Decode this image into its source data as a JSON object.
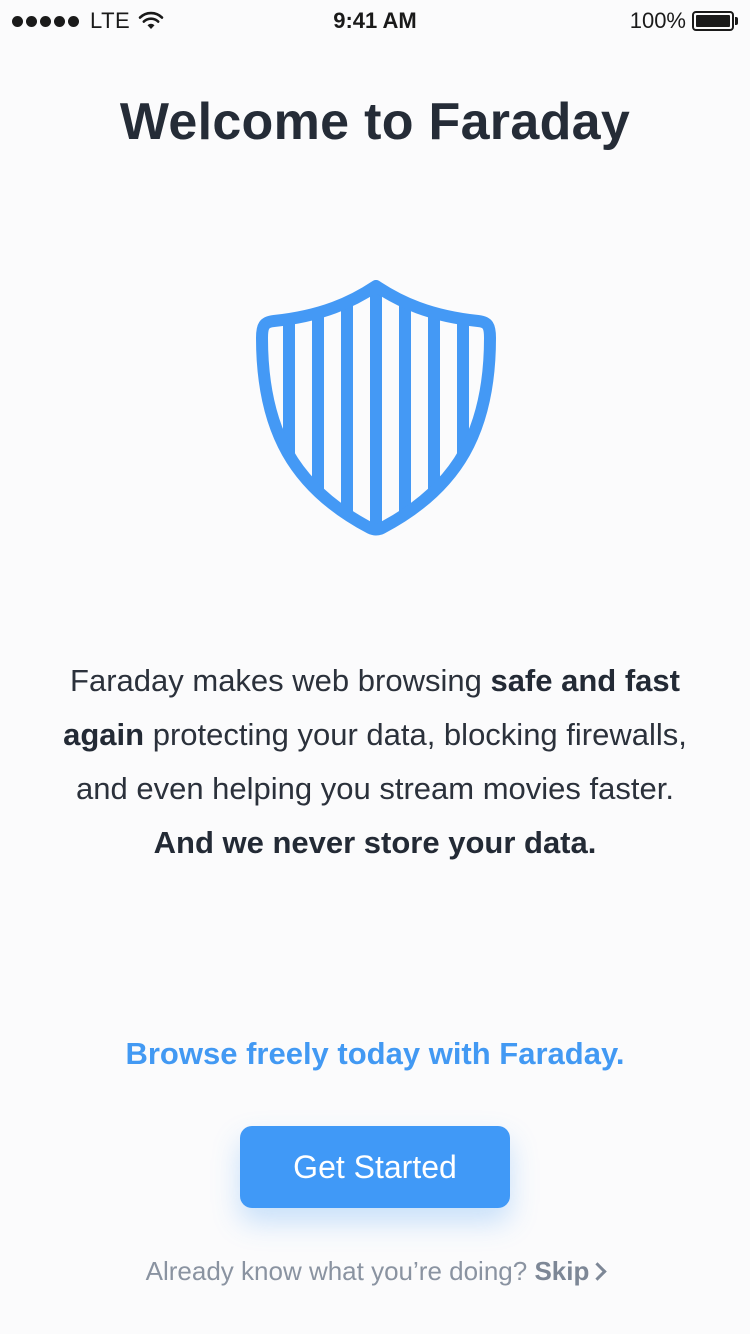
{
  "status_bar": {
    "carrier": "LTE",
    "time": "9:41 AM",
    "battery": "100%"
  },
  "welcome": {
    "title": "Welcome to Faraday",
    "icon": "shield-icon",
    "description": {
      "part1": "Faraday makes web browsing ",
      "bold1": "safe and fast again",
      "part2": " protecting your data, blocking firewalls, and even helping you stream movies faster.",
      "bold2": "And we never store your data."
    },
    "tagline": "Browse freely today with Faraday.",
    "cta_label": "Get Started",
    "skip_prompt": "Already know what you’re doing?",
    "skip_label": "Skip"
  },
  "colors": {
    "accent": "#4099f7",
    "text": "#252c37",
    "muted": "#8a93a1",
    "background": "#fbfbfc"
  }
}
